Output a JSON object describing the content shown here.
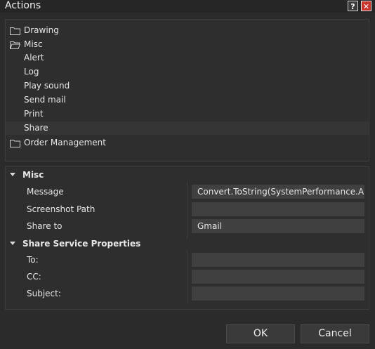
{
  "window": {
    "title": "Actions",
    "help_glyph": "?",
    "close_glyph": "✕"
  },
  "tree": {
    "items": [
      {
        "label": "Drawing",
        "type": "folder"
      },
      {
        "label": "Misc",
        "type": "folder-open"
      },
      {
        "label": "Alert",
        "type": "leaf"
      },
      {
        "label": "Log",
        "type": "leaf"
      },
      {
        "label": "Play sound",
        "type": "leaf"
      },
      {
        "label": "Send mail",
        "type": "leaf"
      },
      {
        "label": "Print",
        "type": "leaf"
      },
      {
        "label": "Share",
        "type": "leaf",
        "selected": true
      },
      {
        "label": "Order Management",
        "type": "folder"
      }
    ]
  },
  "properties": {
    "categories": [
      {
        "label": "Misc",
        "rows": [
          {
            "label": "Message",
            "value": "Convert.ToString(SystemPerformance.A..."
          },
          {
            "label": "Screenshot Path",
            "value": ""
          },
          {
            "label": "Share to",
            "value": "Gmail"
          }
        ]
      },
      {
        "label": "Share Service Properties",
        "rows": [
          {
            "label": "To:",
            "value": ""
          },
          {
            "label": "CC:",
            "value": ""
          },
          {
            "label": "Subject:",
            "value": ""
          }
        ]
      }
    ]
  },
  "buttons": {
    "ok": "OK",
    "cancel": "Cancel"
  },
  "colors": {
    "background": "#2b2b2b",
    "panel": "#2e2e2e",
    "field": "#404040",
    "close_red": "#c8342c"
  }
}
